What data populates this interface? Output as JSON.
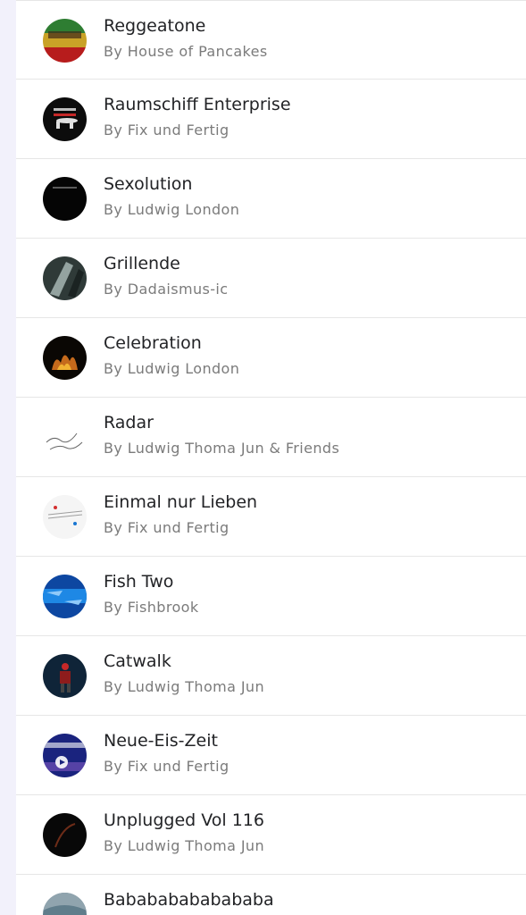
{
  "tracks": [
    {
      "title": "Reggeatone",
      "artist": "By House of Pancakes"
    },
    {
      "title": "Raumschiff Enterprise",
      "artist": "By Fix und Fertig"
    },
    {
      "title": "Sexolution",
      "artist": "By Ludwig London"
    },
    {
      "title": "Grillende",
      "artist": "By Dadaismus-ic"
    },
    {
      "title": "Celebration",
      "artist": "By Ludwig London"
    },
    {
      "title": "Radar",
      "artist": "By Ludwig Thoma Jun & Friends"
    },
    {
      "title": "Einmal nur Lieben",
      "artist": "By Fix und Fertig"
    },
    {
      "title": "Fish Two",
      "artist": "By Fishbrook"
    },
    {
      "title": "Catwalk",
      "artist": "By Ludwig Thoma Jun"
    },
    {
      "title": "Neue-Eis-Zeit",
      "artist": "By Fix und Fertig"
    },
    {
      "title": "Unplugged Vol 116",
      "artist": "By Ludwig Thoma Jun"
    },
    {
      "title": "Babababababababa",
      "artist": ""
    }
  ]
}
